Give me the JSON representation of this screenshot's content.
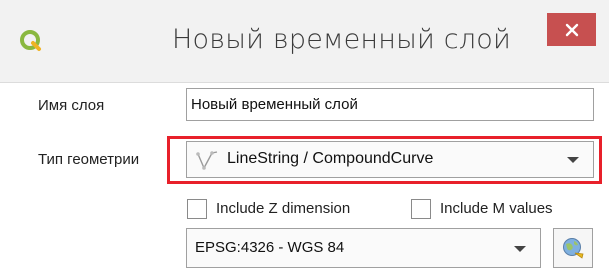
{
  "window": {
    "title": "Новый временный слой",
    "close_icon": "close-icon",
    "logo_icon": "qgis-logo-icon",
    "close_color": "#c75050"
  },
  "form": {
    "layer_name_label": "Имя слоя",
    "layer_name_value": "Новый временный слой",
    "geometry_type_label": "Тип геометрии",
    "geometry_type_value": "LineString / CompoundCurve",
    "geometry_type_icon": "linestring-icon",
    "include_z_label": "Include Z dimension",
    "include_z_checked": false,
    "include_m_label": "Include M values",
    "include_m_checked": false,
    "crs_value": "EPSG:4326 - WGS 84",
    "crs_select_icon": "globe-crs-icon"
  },
  "highlight": {
    "color": "#e8202a",
    "target": "geometry-type-combo"
  }
}
